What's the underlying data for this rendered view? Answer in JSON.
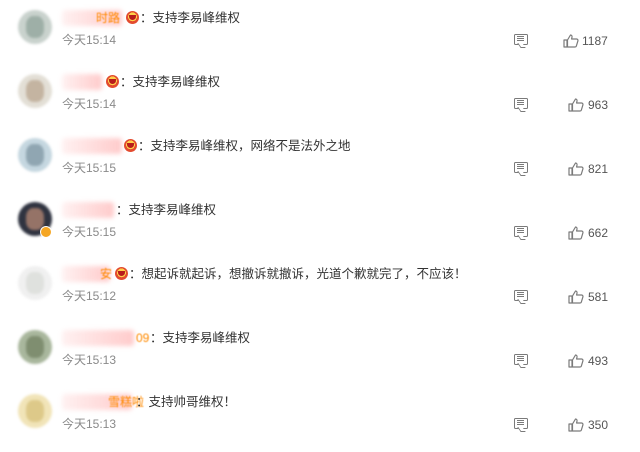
{
  "comments": [
    {
      "name_tail": "时路",
      "has_medal": true,
      "text": "：支持李易峰维权",
      "time": "今天15:14",
      "likes": "1187",
      "avatar_colors": [
        "#c9d2cd",
        "#8fa39a"
      ]
    },
    {
      "name_tail": "",
      "has_medal": true,
      "text": "：支持李易峰维权",
      "time": "今天15:14",
      "likes": "963",
      "avatar_colors": [
        "#e3dfd6",
        "#b9a58f"
      ]
    },
    {
      "name_tail": "",
      "has_medal": true,
      "text": "：支持李易峰维权，网络不是法外之地",
      "time": "今天15:15",
      "likes": "821",
      "avatar_colors": [
        "#c5d7e0",
        "#7d95a3"
      ]
    },
    {
      "name_tail": "",
      "has_medal": false,
      "has_vbadge": true,
      "text": "：支持李易峰维权",
      "time": "今天15:15",
      "likes": "662",
      "avatar_colors": [
        "#2f3340",
        "#b88a74"
      ]
    },
    {
      "name_tail": "安",
      "has_medal": true,
      "text": "：想起诉就起诉，想撤诉就撤诉，光道个歉就完了，不应该！",
      "time": "今天15:12",
      "likes": "581",
      "avatar_colors": [
        "#f0f0f0",
        "#d9dcd8"
      ]
    },
    {
      "name_tail": "09",
      "has_medal": false,
      "text": "：支持李易峰维权",
      "time": "今天15:13",
      "likes": "493",
      "avatar_colors": [
        "#a9b79d",
        "#718061"
      ]
    },
    {
      "name_tail": "雪糕啦",
      "has_medal": false,
      "text": "：支持帅哥维权！",
      "time": "今天15:13",
      "likes": "350",
      "avatar_colors": [
        "#f1e4b8",
        "#d6c07a"
      ]
    }
  ]
}
